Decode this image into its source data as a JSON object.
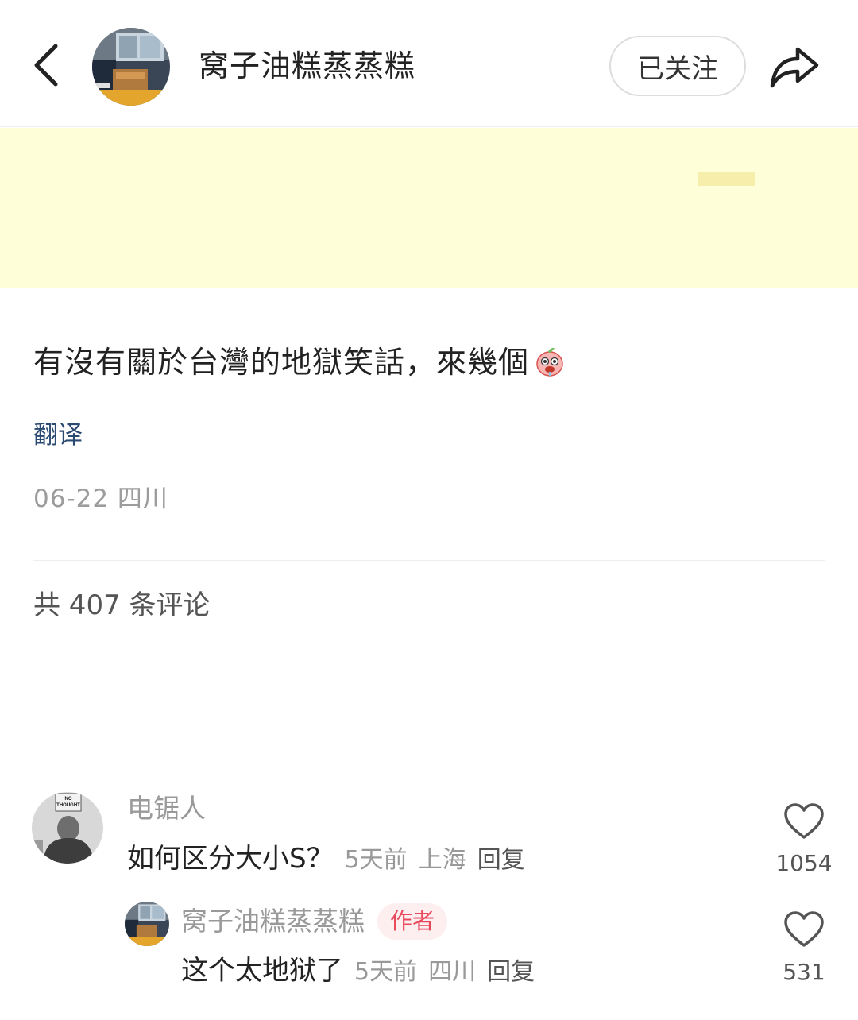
{
  "header": {
    "back_icon": "chevron-left-icon",
    "author_name": "窝子油糕蒸蒸糕",
    "follow_label": "已关注",
    "share_icon": "share-arrow-icon"
  },
  "post": {
    "text": "有沒有關於台灣的地獄笑話，來幾個",
    "emoji": "drooling-face-sticker",
    "translate_label": "翻译",
    "meta": "06-22 四川"
  },
  "comments_header": {
    "count_text": "共 407 条评论"
  },
  "comments": [
    {
      "user": "电锯人",
      "text": "如何区分大小S？",
      "time": "5天前",
      "location": "上海",
      "reply_label": "回复",
      "likes": "1054"
    },
    {
      "user": "窝子油糕蒸蒸糕",
      "author_tag": "作者",
      "text": "这个太地狱了",
      "time": "5天前",
      "location": "四川",
      "reply_label": "回复",
      "likes": "531"
    }
  ],
  "colors": {
    "banner": "#fefed9",
    "link": "#2b4a72",
    "author_tag_bg": "#fdeef0",
    "author_tag_text": "#e8485b"
  }
}
